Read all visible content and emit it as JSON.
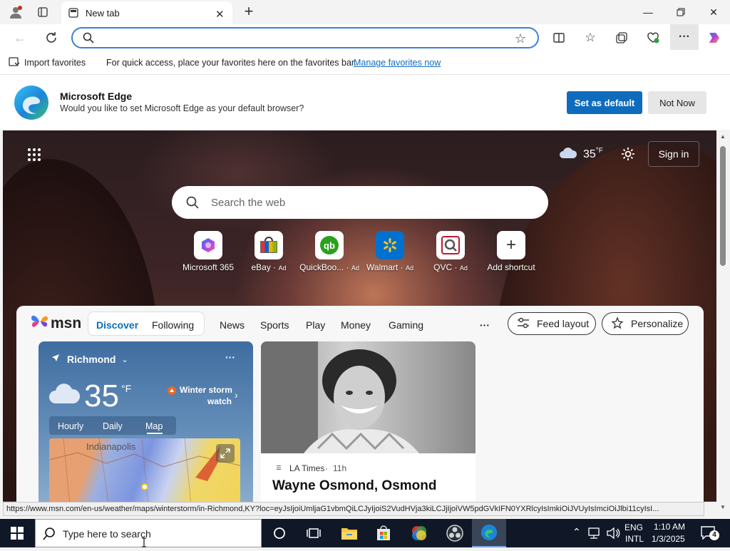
{
  "browser": {
    "tab_title": "New tab",
    "address_value": "",
    "favorites_bar": {
      "import_label": "Import favorites",
      "message": "For quick access, place your favorites here on the favorites bar.",
      "manage_link": "Manage favorites now"
    },
    "banner": {
      "title": "Microsoft Edge",
      "subtitle": "Would you like to set Microsoft Edge as your default browser?",
      "primary": "Set as default",
      "secondary": "Not Now"
    },
    "status_url": "https://www.msn.com/en-us/weather/maps/winterstorm/in-Richmond,KY?loc=eyJsIjoiUmljaG1vbmQiLCJyIjoiS2VudHVja3kiLCJjIjoiVW5pdGVkIFN0YXRlcyIsImkiOiJVUyIsImciOiJlbi11cyIsI..."
  },
  "colors": {
    "accent": "#0f6cbd",
    "address_border": "#3f7fd6",
    "taskbar": "#101828"
  },
  "newtab": {
    "weather_temp": "35",
    "weather_unit": "°F",
    "sign_in": "Sign in",
    "search_placeholder": "Search the web",
    "shortcuts": [
      {
        "label": "Microsoft 365",
        "ad": ""
      },
      {
        "label": "eBay",
        "ad": "Ad"
      },
      {
        "label": "QuickBoo...",
        "ad": "Ad"
      },
      {
        "label": "Walmart",
        "ad": "Ad"
      },
      {
        "label": "QVC",
        "ad": "Ad"
      },
      {
        "label": "Add shortcut",
        "ad": ""
      }
    ]
  },
  "msn": {
    "logo": "msn",
    "tabs": [
      "Discover",
      "Following"
    ],
    "nav": [
      "News",
      "Sports",
      "Play",
      "Money",
      "Gaming"
    ],
    "more": "···",
    "feed_layout": "Feed layout",
    "personalize": "Personalize"
  },
  "weather_card": {
    "location": "Richmond",
    "temp": "35",
    "unit": "°F",
    "alert_line1": "Winter storm",
    "alert_line2": "watch",
    "tabs": [
      "Hourly",
      "Daily",
      "Map"
    ],
    "map_city": "Indianapolis",
    "more": "···"
  },
  "news_card": {
    "source": "LA Times",
    "age": "11h",
    "headline": "Wayne Osmond, Osmond"
  },
  "taskbar": {
    "search_placeholder": "Type here to search",
    "lang_line1": "ENG",
    "lang_line2": "INTL",
    "time": "1:10 AM",
    "date": "1/3/2025",
    "notification_count": "4"
  }
}
